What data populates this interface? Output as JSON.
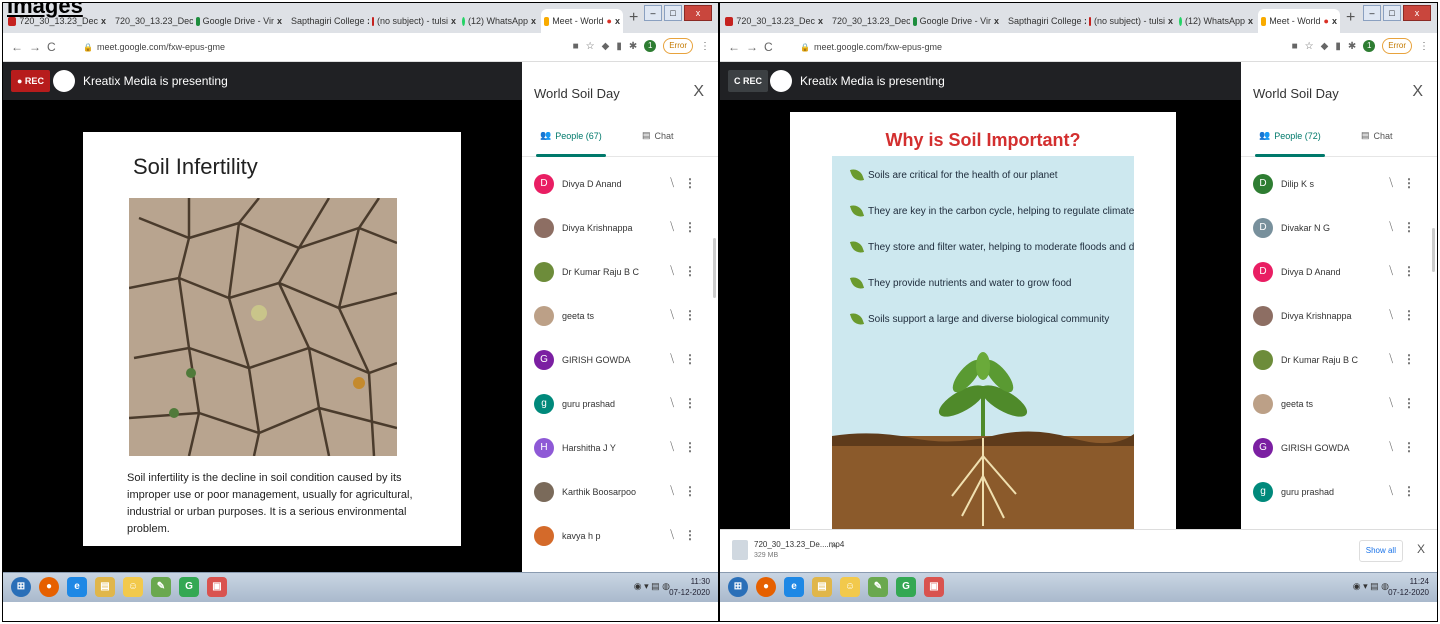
{
  "caption": "Images",
  "left": {
    "tabs": [
      {
        "label": "720_30_13.23_Dec",
        "color": "#c5221f",
        "icon": "gmail-icon"
      },
      {
        "label": "720_30_13.23_Dec",
        "color": "#1e8e3e",
        "icon": "drive-icon"
      },
      {
        "label": "Google Drive - Vir",
        "color": "#1e8e3e",
        "icon": "drive-icon"
      },
      {
        "label": "Sapthagiri College",
        "color": "#1a73e8",
        "icon": "docs-icon"
      },
      {
        "label": "(no subject) - tulsi",
        "color": "#c5221f",
        "icon": "gmail-icon"
      },
      {
        "label": "(12) WhatsApp",
        "color": "#25d366",
        "icon": "whatsapp-icon"
      },
      {
        "label": "Meet - World",
        "color": "#f9ab00",
        "icon": "meet-icon"
      }
    ],
    "url": "meet.google.com/fxw-epus-gme",
    "error": "Error",
    "profile": "1",
    "rec": "● REC",
    "presenting": "Kreatix Media is presenting",
    "panel_title": "World Soil Day",
    "people_tab": "People (67)",
    "chat_tab": "Chat",
    "people": [
      {
        "name": "Divya D Anand",
        "initial": "D",
        "color": "#e91e63"
      },
      {
        "name": "Divya Krishnappa",
        "initial": "",
        "color": "#8d6e63"
      },
      {
        "name": "Dr Kumar Raju B C",
        "initial": "",
        "color": "#6d8c3a"
      },
      {
        "name": "geeta ts",
        "initial": "",
        "color": "#bca087"
      },
      {
        "name": "GIRISH GOWDA",
        "initial": "G",
        "color": "#7b1fa2"
      },
      {
        "name": "guru prashad",
        "initial": "g",
        "color": "#00897b"
      },
      {
        "name": "Harshitha J Y",
        "initial": "H",
        "color": "#8e59d6"
      },
      {
        "name": "Karthik Boosarpoo",
        "initial": "",
        "color": "#7a6a5a"
      },
      {
        "name": "kavya h p",
        "initial": "",
        "color": "#d46a2a"
      }
    ],
    "slide_title": "Soil Infertility",
    "slide_text": "Soil infertility is the decline in soil condition caused by its improper use or poor management, usually for agricultural, industrial or urban purposes. It is a serious environmental problem.",
    "clock_time": "11:30",
    "clock_date": "07-12-2020"
  },
  "right": {
    "tabs": [
      {
        "label": "720_30_13.23_Dec",
        "color": "#c5221f",
        "icon": "gmail-icon"
      },
      {
        "label": "720_30_13.23_Dec",
        "color": "#1e8e3e",
        "icon": "drive-icon"
      },
      {
        "label": "Google Drive - Vir",
        "color": "#1e8e3e",
        "icon": "drive-icon"
      },
      {
        "label": "Sapthagiri College",
        "color": "#1a73e8",
        "icon": "docs-icon"
      },
      {
        "label": "(no subject) - tulsi",
        "color": "#c5221f",
        "icon": "gmail-icon"
      },
      {
        "label": "(12) WhatsApp",
        "color": "#25d366",
        "icon": "whatsapp-icon"
      },
      {
        "label": "Meet - World",
        "color": "#f9ab00",
        "icon": "meet-icon"
      }
    ],
    "url": "meet.google.com/fxw-epus-gme",
    "error": "Error",
    "profile": "1",
    "rec": "C REC",
    "presenting": "Kreatix Media is presenting",
    "panel_title": "World Soil Day",
    "people_tab": "People (72)",
    "chat_tab": "Chat",
    "people": [
      {
        "name": "Dilip K s",
        "initial": "D",
        "color": "#2e7d32"
      },
      {
        "name": "Divakar N G",
        "initial": "D",
        "color": "#78909c"
      },
      {
        "name": "Divya D Anand",
        "initial": "D",
        "color": "#e91e63"
      },
      {
        "name": "Divya Krishnappa",
        "initial": "",
        "color": "#8d6e63"
      },
      {
        "name": "Dr Kumar Raju B C",
        "initial": "",
        "color": "#6d8c3a"
      },
      {
        "name": "geeta ts",
        "initial": "",
        "color": "#bca087"
      },
      {
        "name": "GIRISH GOWDA",
        "initial": "G",
        "color": "#7b1fa2"
      },
      {
        "name": "guru prashad",
        "initial": "g",
        "color": "#00897b"
      }
    ],
    "slide_title": "Why is Soil Important?",
    "bullets": [
      "Soils are critical for the health of our planet",
      "They are key in the carbon cycle, helping to regulate climate",
      "They store and filter water, helping to moderate floods and droughts",
      "They provide nutrients and water to grow food",
      "Soils support a large and diverse biological community"
    ],
    "download_name": "720_30_13.23_De....mp4",
    "download_size": "329 MB",
    "show_all": "Show all",
    "clock_time": "11:24",
    "clock_date": "07-12-2020"
  }
}
